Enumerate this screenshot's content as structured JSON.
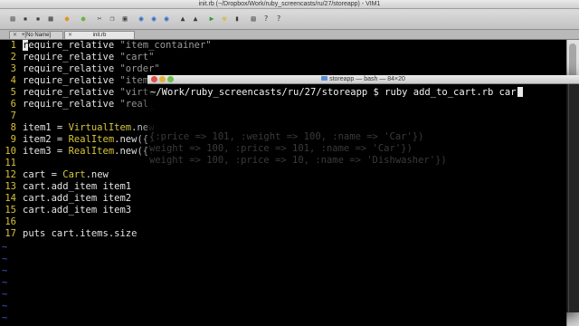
{
  "colors": {
    "line_number": "#d6c23a",
    "constant": "#d8c63c",
    "string": "#9a9a9a",
    "text": "#e4e4e4",
    "tilde": "#3e57c9",
    "term_text": "#f2f2f2"
  },
  "vim": {
    "title": "init.rb (~/Dropbox/Work/ruby_screencasts/ru/27/storeapp) - VIM1",
    "toolbar": [
      {
        "icon": "open-file-icon"
      },
      {
        "icon": "save-icon"
      },
      {
        "icon": "save-all-icon"
      },
      {
        "icon": "print-icon"
      },
      {
        "icon": "undo-icon"
      },
      {
        "icon": "redo-icon"
      },
      {
        "icon": "cut-icon"
      },
      {
        "icon": "copy-icon"
      },
      {
        "icon": "paste-icon"
      },
      {
        "icon": "find-icon"
      },
      {
        "icon": "find-next-icon"
      },
      {
        "icon": "find-prev-icon"
      },
      {
        "icon": "load-session-icon"
      },
      {
        "icon": "save-session-icon"
      },
      {
        "icon": "run-script-icon"
      },
      {
        "icon": "make-icon"
      },
      {
        "icon": "shell-icon"
      },
      {
        "icon": "ctags-icon"
      },
      {
        "icon": "help-icon"
      },
      {
        "icon": "find-help-icon"
      }
    ],
    "tabs": [
      {
        "label": "+[No Name]",
        "active": false
      },
      {
        "label": "init.rb",
        "active": true
      }
    ],
    "lines": [
      {
        "n": "1",
        "parts": [
          [
            "c",
            "r"
          ],
          [
            "t",
            "equire_relative "
          ],
          [
            "s",
            "\"item_container\""
          ]
        ]
      },
      {
        "n": "2",
        "parts": [
          [
            "t",
            "require_relative "
          ],
          [
            "s",
            "\"cart\""
          ]
        ]
      },
      {
        "n": "3",
        "parts": [
          [
            "t",
            "require_relative "
          ],
          [
            "s",
            "\"order\""
          ]
        ]
      },
      {
        "n": "4",
        "parts": [
          [
            "t",
            "require_relative "
          ],
          [
            "s",
            "\"item"
          ]
        ]
      },
      {
        "n": "5",
        "parts": [
          [
            "t",
            "require_relative "
          ],
          [
            "s",
            "\"virtu"
          ]
        ]
      },
      {
        "n": "6",
        "parts": [
          [
            "t",
            "require_relative "
          ],
          [
            "s",
            "\"real_"
          ]
        ]
      },
      {
        "n": "7",
        "parts": []
      },
      {
        "n": "8",
        "parts": [
          [
            "t",
            "item1 = "
          ],
          [
            "k",
            "VirtualItem"
          ],
          [
            "t",
            ".new"
          ]
        ]
      },
      {
        "n": "9",
        "parts": [
          [
            "t",
            "item2 = "
          ],
          [
            "k",
            "RealItem"
          ],
          [
            "t",
            ".new({:"
          ]
        ]
      },
      {
        "n": "10",
        "parts": [
          [
            "t",
            "item3 = "
          ],
          [
            "k",
            "RealItem"
          ],
          [
            "t",
            ".new({:"
          ]
        ]
      },
      {
        "n": "11",
        "parts": []
      },
      {
        "n": "12",
        "parts": [
          [
            "t",
            "cart = "
          ],
          [
            "k",
            "Cart"
          ],
          [
            "t",
            ".new"
          ]
        ]
      },
      {
        "n": "13",
        "parts": [
          [
            "t",
            "cart.add_item item1"
          ]
        ]
      },
      {
        "n": "14",
        "parts": [
          [
            "t",
            "cart.add_item item2"
          ]
        ]
      },
      {
        "n": "15",
        "parts": [
          [
            "t",
            "cart.add_item item3"
          ]
        ]
      },
      {
        "n": "16",
        "parts": []
      },
      {
        "n": "17",
        "parts": [
          [
            "t",
            "puts cart.items.size"
          ]
        ]
      }
    ],
    "tilde": "~"
  },
  "terminal": {
    "title": "storeapp — bash — 84×20",
    "prompt_line": "~/Work/ruby_screencasts/ru/27/storeapp $ ruby add_to_cart.rb car"
  }
}
